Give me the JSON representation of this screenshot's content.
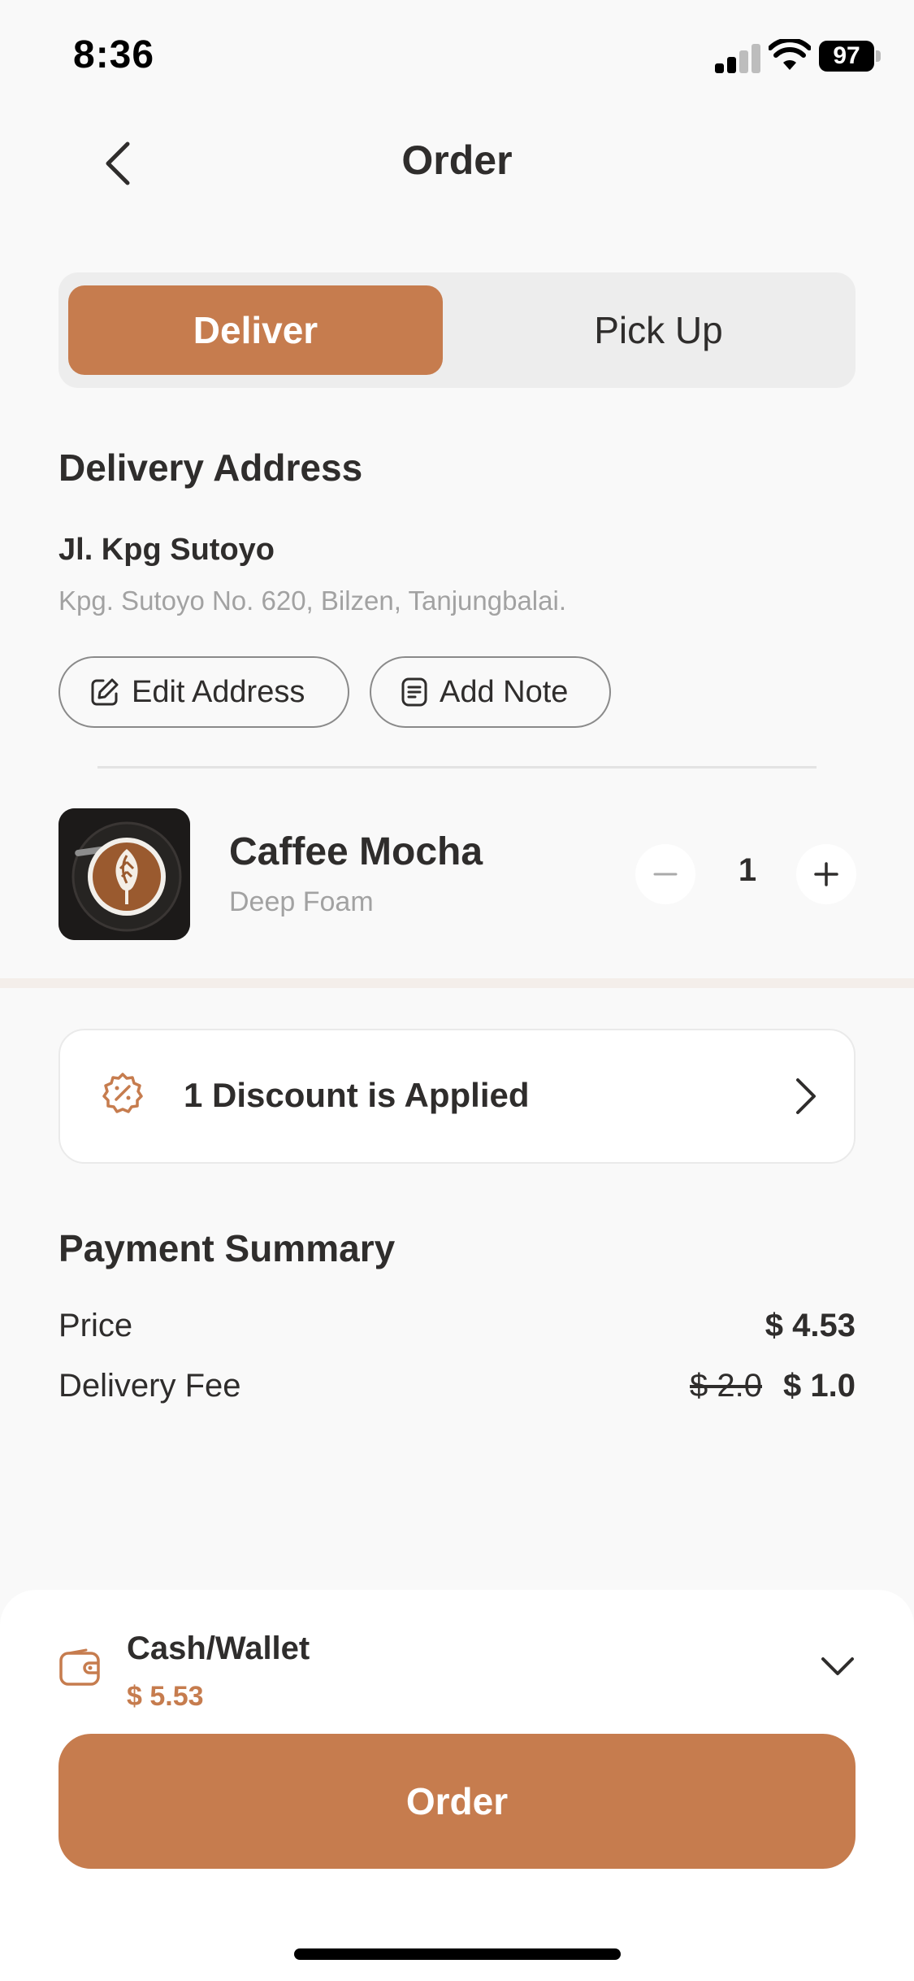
{
  "status_bar": {
    "time": "8:36",
    "battery": "97"
  },
  "header": {
    "title": "Order"
  },
  "tabs": [
    {
      "label": "Deliver",
      "active": true
    },
    {
      "label": "Pick Up",
      "active": false
    }
  ],
  "address": {
    "section_title": "Delivery Address",
    "name": "Jl. Kpg Sutoyo",
    "detail": "Kpg. Sutoyo No. 620, Bilzen, Tanjungbalai.",
    "edit_label": "Edit Address",
    "note_label": "Add Note"
  },
  "product": {
    "name": "Caffee Mocha",
    "subtitle": "Deep Foam",
    "quantity": "1"
  },
  "discount": {
    "label": "1 Discount is Applied"
  },
  "payment_summary": {
    "title": "Payment Summary",
    "price_label": "Price",
    "price_value": "$ 4.53",
    "delivery_label": "Delivery Fee",
    "delivery_original": "$ 2.0",
    "delivery_value": "$ 1.0"
  },
  "checkout": {
    "method": "Cash/Wallet",
    "amount": "$ 5.53",
    "order_label": "Order"
  },
  "colors": {
    "accent": "#C67C4E",
    "text": "#2F2D2C",
    "muted": "#A2A2A2",
    "background": "#F9F9F9"
  }
}
